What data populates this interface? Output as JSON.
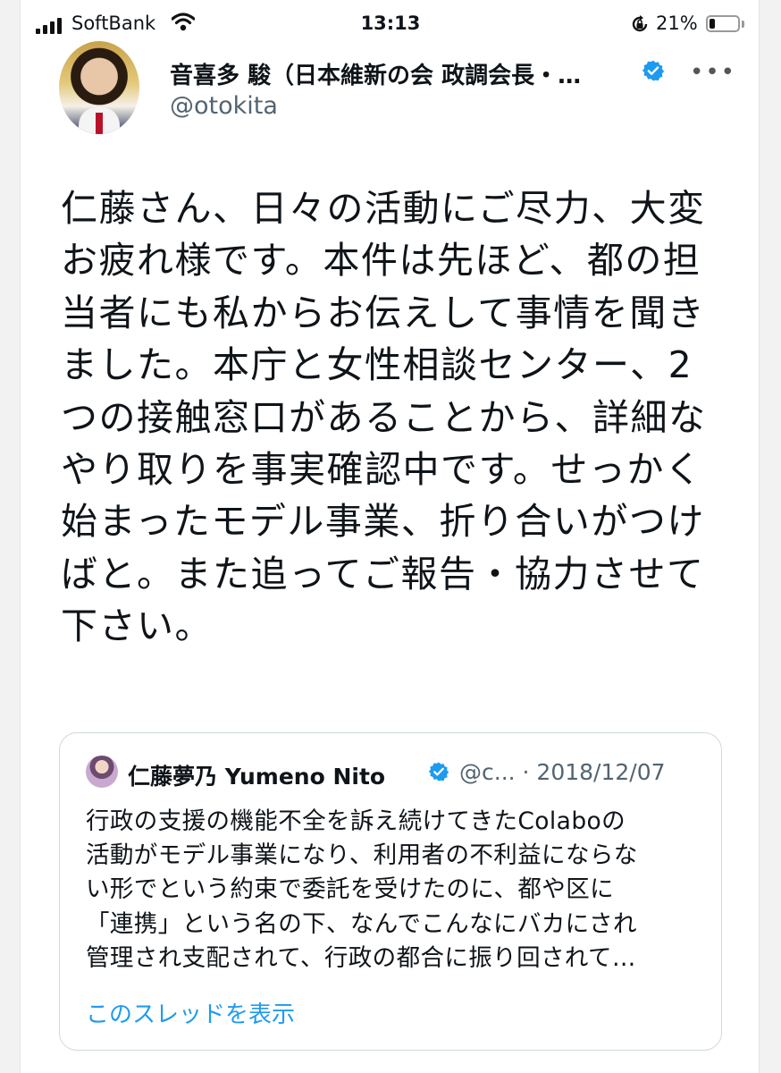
{
  "status_bar": {
    "carrier": "SoftBank",
    "time": "13:13",
    "battery_percent": "21%",
    "battery_level": 0.21,
    "icons": [
      "signal-icon",
      "wifi-icon",
      "rotation-lock-icon",
      "battery-icon"
    ]
  },
  "tweet": {
    "author_name": "音喜多 駿（日本維新の会 政調会長・…",
    "handle": "@otokita",
    "verified": true,
    "more_icon": "more-icon",
    "lines": [
      "仁藤さん、日々の活動にご尽力、大変",
      "お疲れ様です。本件は先ほど、都の担",
      "当者にも私からお伝えして事情を聞き",
      "ました。本庁と女性相談センター、2",
      "つの接触窓口があることから、詳細な",
      "やり取りを事実確認中です。せっかく",
      "始まったモデル事業、折り合いがつけ",
      "ばと。また追ってご報告・協力させて",
      "下さい。"
    ]
  },
  "quoted_tweet": {
    "author_name": "仁藤夢乃 Yumeno Nito",
    "handle_date": "@c... · 2018/12/07",
    "verified": true,
    "lines": [
      "行政の支援の機能不全を訴え続けてきたColaboの",
      "活動がモデル事業になり、利用者の不利益にならな",
      "い形でという約束で委託を受けたのに、都や区に",
      "「連携」という名の下、なんでこんなにバカにされ",
      "管理され支配されて、行政の都合に振り回されて…"
    ],
    "show_thread": "このスレッドを表示"
  },
  "colors": {
    "accent": "#1d9bf0",
    "text": "#0f1419",
    "secondary": "#536471"
  }
}
